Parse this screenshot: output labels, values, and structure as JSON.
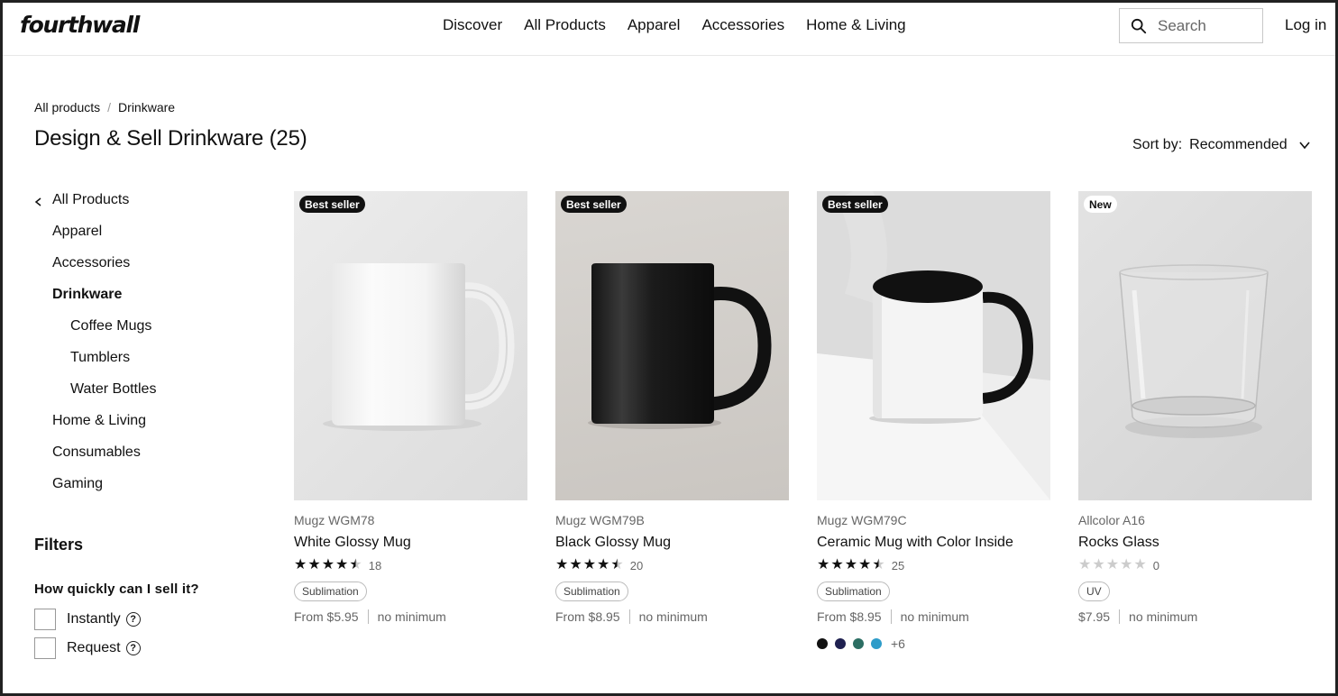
{
  "header": {
    "logo": "fourthwall",
    "nav": [
      "Discover",
      "All Products",
      "Apparel",
      "Accessories",
      "Home & Living"
    ],
    "search_placeholder": "Search",
    "login": "Log in"
  },
  "breadcrumb": {
    "root": "All products",
    "separator": "/",
    "current": "Drinkware"
  },
  "title": "Design & Sell Drinkware (25)",
  "sort": {
    "label": "Sort by:",
    "value": "Recommended"
  },
  "sidebar": {
    "back": "All Products",
    "items": [
      "Apparel",
      "Accessories",
      "Drinkware",
      "Coffee Mugs",
      "Tumblers",
      "Water Bottles",
      "Home & Living",
      "Consumables",
      "Gaming"
    ]
  },
  "filters": {
    "title": "Filters",
    "question": "How quickly can I sell it?",
    "options": [
      "Instantly",
      "Request"
    ],
    "help_glyph": "?"
  },
  "products": [
    {
      "badge": "Best seller",
      "brand": "Mugz WGM78",
      "name": "White Glossy Mug",
      "rating": 4.5,
      "reviews": "18",
      "tag": "Sublimation",
      "price": "From $5.95",
      "minimum": "no minimum"
    },
    {
      "badge": "Best seller",
      "brand": "Mugz WGM79B",
      "name": "Black Glossy Mug",
      "rating": 4.5,
      "reviews": "20",
      "tag": "Sublimation",
      "price": "From $8.95",
      "minimum": "no minimum"
    },
    {
      "badge": "Best seller",
      "brand": "Mugz WGM79C",
      "name": "Ceramic Mug with Color Inside",
      "rating": 4.5,
      "reviews": "25",
      "tag": "Sublimation",
      "price": "From $8.95",
      "minimum": "no minimum",
      "swatches": [
        "#111111",
        "#1f2050",
        "#2c6e63",
        "#2e9cc9"
      ],
      "more_colors": "+6"
    },
    {
      "badge": "New",
      "brand": "Allcolor A16",
      "name": "Rocks Glass",
      "rating": 0,
      "reviews": "0",
      "tag": "UV",
      "price": "$7.95",
      "minimum": "no minimum"
    }
  ]
}
